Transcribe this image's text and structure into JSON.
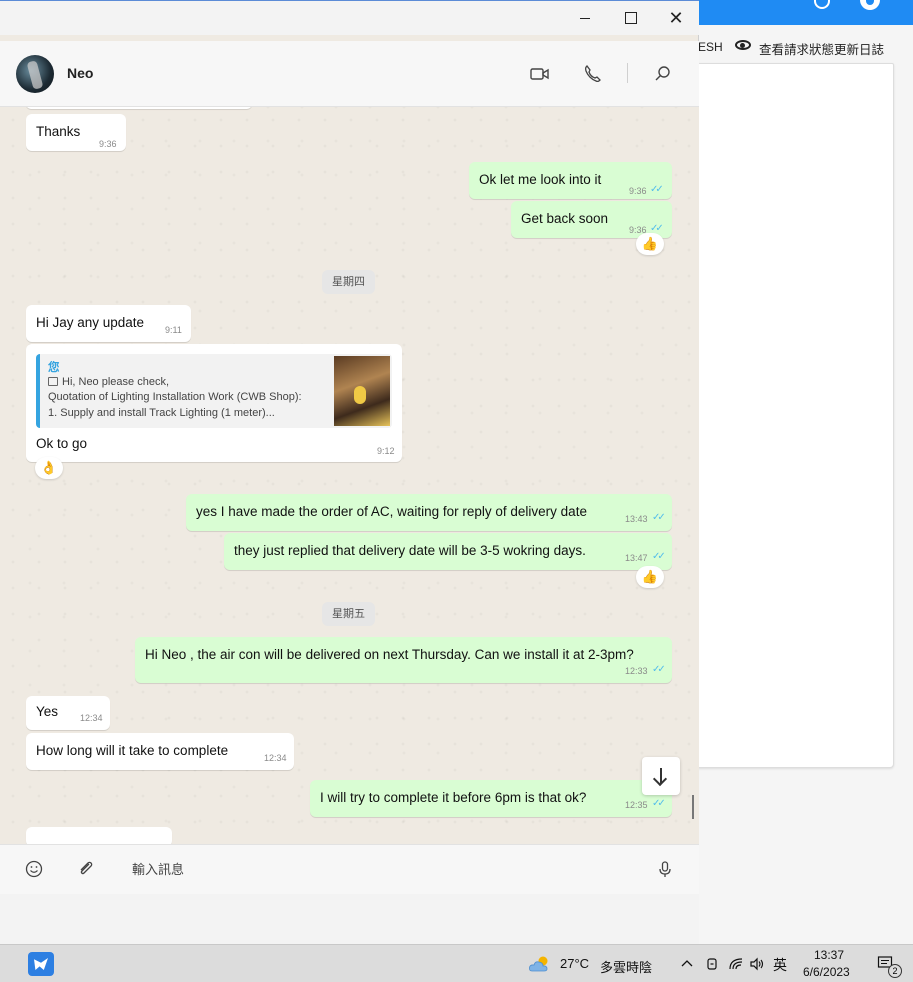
{
  "background_app": {
    "refresh_text": "ESH",
    "log_text": "查看請求狀態更新日誌"
  },
  "header": {
    "contact_name": "Neo"
  },
  "chat": {
    "date_thursday": "星期四",
    "date_friday": "星期五",
    "messages": [
      {
        "dir": "in",
        "text": "Thanks",
        "time": "9:36"
      },
      {
        "dir": "out",
        "text": "Ok let me look into it",
        "time": "9:36"
      },
      {
        "dir": "out",
        "text": "Get back soon",
        "time": "9:36",
        "reaction": "👍"
      },
      {
        "dir": "in",
        "text": "Hi Jay any update",
        "time": "9:11"
      },
      {
        "dir": "in",
        "text": "Ok to go",
        "time": "9:12",
        "reaction": "👌",
        "quote": {
          "author": "您",
          "line1": "Hi, Neo please check,",
          "line2": "Quotation of Lighting Installation Work (CWB Shop):",
          "line3": "1. Supply and install Track Lighting (1 meter)..."
        }
      },
      {
        "dir": "out",
        "text": "yes I have made the order of AC, waiting for reply of delivery date",
        "time": "13:43"
      },
      {
        "dir": "out",
        "text": "they just replied that delivery date will be 3-5 wokring days.",
        "time": "13:47",
        "reaction": "👍"
      },
      {
        "dir": "out",
        "text": "Hi Neo , the air con will be delivered on next Thursday.  Can we install it at 2-3pm?",
        "time": "12:33"
      },
      {
        "dir": "in",
        "text": "Yes",
        "time": "12:34"
      },
      {
        "dir": "in",
        "text": "How long will it take to complete",
        "time": "12:34"
      },
      {
        "dir": "out",
        "text": "I will try to complete it before 6pm is that ok?",
        "time": "12:35"
      }
    ]
  },
  "composer": {
    "placeholder": "輸入訊息"
  },
  "taskbar": {
    "temperature": "27°C",
    "weather": "多雲時陰",
    "ime": "英",
    "time": "13:37",
    "date": "6/6/2023",
    "notification_count": "2"
  }
}
